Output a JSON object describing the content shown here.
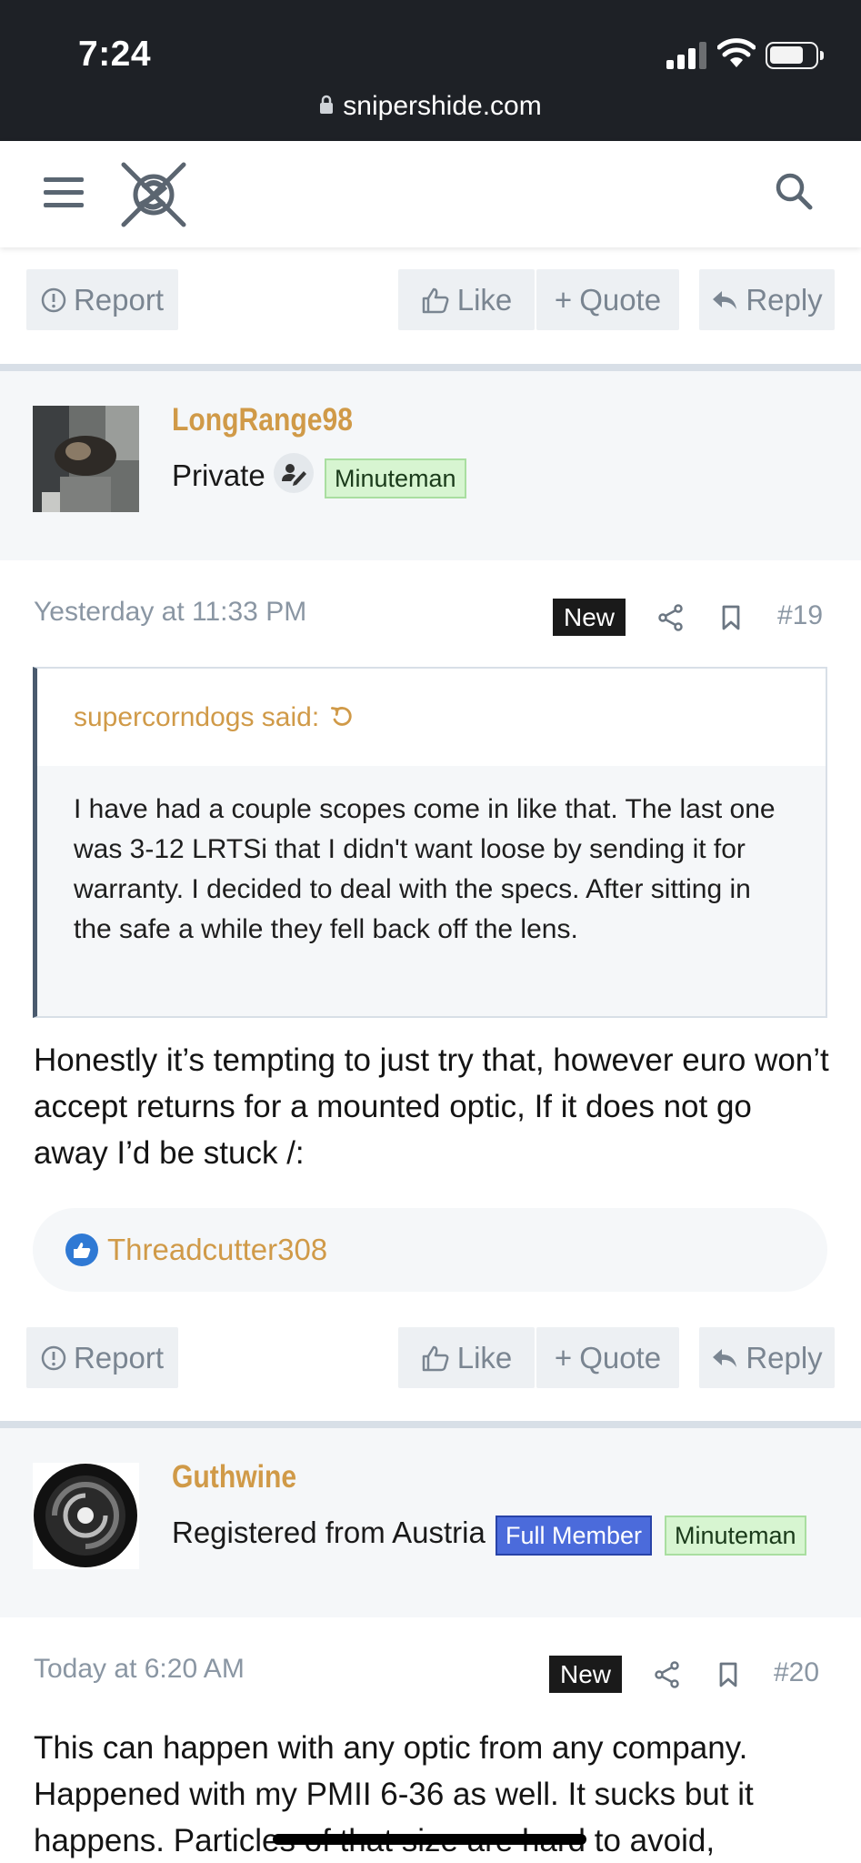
{
  "status_bar": {
    "time": "7:24",
    "url": "snipershide.com"
  },
  "actions": {
    "report": "Report",
    "like": "Like",
    "quote": "Quote",
    "reply": "Reply"
  },
  "posts": [
    {
      "username": "LongRange98",
      "user_title": "Private",
      "banners": [
        "Minuteman"
      ],
      "date": "Yesterday at 11:33 PM",
      "new_label": "New",
      "number": "#19",
      "quote": {
        "author": "supercorndogs said:",
        "text": "I have had a couple scopes come in like that. The last one was 3-12 LRTSi that I didn't want loose by sending it for warranty. I decided to deal with the specs. After sitting in the safe a while they fell back off the lens."
      },
      "text": "Honestly it’s tempting to just try that, however euro won’t accept returns for a mounted optic, If it does not go away I’d be stuck /:",
      "likes_by": "Threadcutter308"
    },
    {
      "username": "Guthwine",
      "user_title": "Registered from Austria",
      "banners": [
        "Full Member",
        "Minuteman"
      ],
      "date": "Today at 6:20 AM",
      "new_label": "New",
      "number": "#20",
      "text": "This can happen with any optic from any company. Happened with my PMII 6-36 as well. It sucks but it happens. Particles of that size are hard to avoid,"
    }
  ],
  "colors": {
    "username": "#d09a48",
    "status_bar": "#1e2126",
    "full_member": "#4b6bdb",
    "minuteman": "#d7f5d1"
  }
}
